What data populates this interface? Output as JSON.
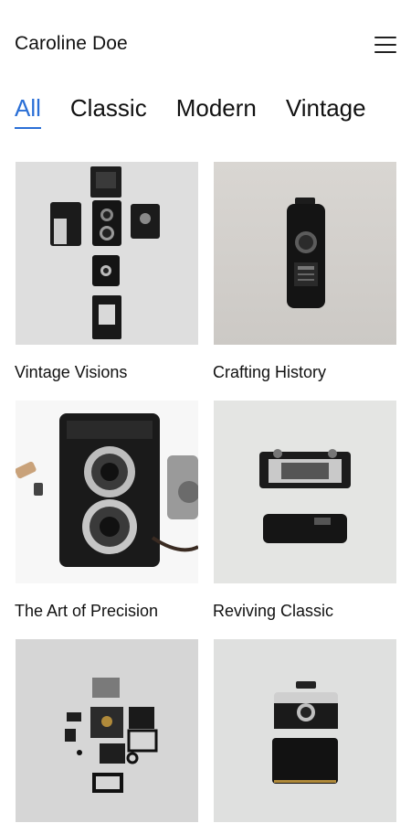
{
  "header": {
    "brand": "Caroline Doe",
    "menu_icon": "hamburger-menu-icon"
  },
  "tabs": [
    {
      "label": "All",
      "active": true
    },
    {
      "label": "Classic",
      "active": false
    },
    {
      "label": "Modern",
      "active": false
    },
    {
      "label": "Vintage",
      "active": false
    }
  ],
  "gallery": [
    {
      "title": "Vintage Visions",
      "image": "exploded vintage camera parts arranged in cross shape"
    },
    {
      "title": "Crafting History",
      "image": "black vintage film camera on beige background"
    },
    {
      "title": "The Art of Precision",
      "image": "Rolleiflex twin-lens reflex camera"
    },
    {
      "title": "Reviving Classic",
      "image": "rangefinder camera with body separated"
    },
    {
      "title": "",
      "image": "disassembled camera components laid flat"
    },
    {
      "title": "",
      "image": "vintage rangefinder camera above leather case"
    }
  ],
  "colors": {
    "accent": "#2a6fd6",
    "text": "#111111",
    "background": "#ffffff"
  }
}
